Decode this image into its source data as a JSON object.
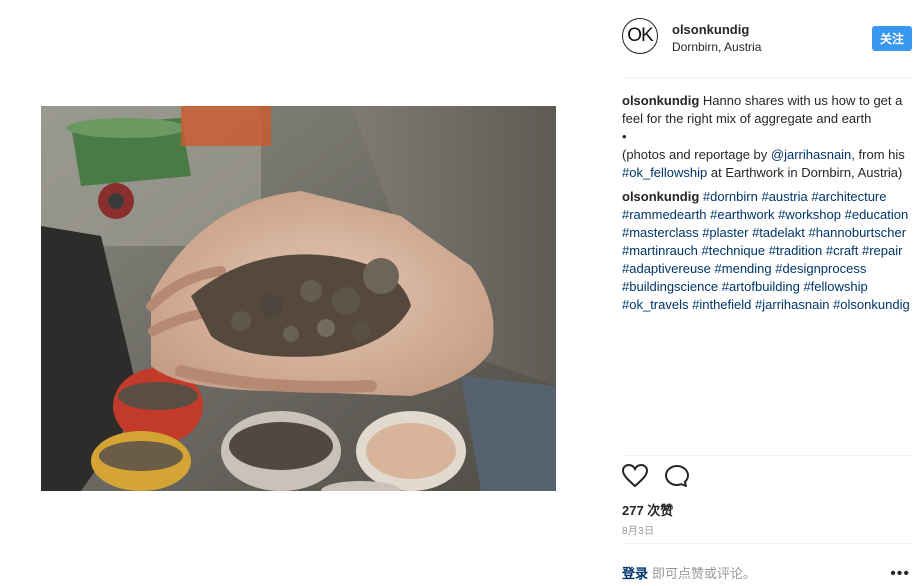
{
  "header": {
    "username": "olsonkundig",
    "location": "Dornbirn, Austria",
    "follow_label": "关注",
    "avatar_text": "OK"
  },
  "caption": {
    "username": "olsonkundig",
    "line1": "Hanno shares with us how to get a feel for the right mix of aggregate and earth",
    "bullet": "•",
    "line2_pre": "(photos and reportage by ",
    "mention": "@jarrihasnain",
    "line2_mid": ", from his ",
    "hashtag": "#ok_fellowship",
    "line2_post": " at Earthwork in Dornbirn, Austria)"
  },
  "tags_comment": {
    "username": "olsonkundig",
    "tags": [
      "#dornbirn",
      "#austria",
      "#architecture",
      "#rammedearth",
      "#earthwork",
      "#workshop",
      "#education",
      "#masterclass",
      "#plaster",
      "#tadelakt",
      "#hannoburtscher",
      "#martinrauch",
      "#technique",
      "#tradition",
      "#craft",
      "#repair",
      "#adaptivereuse",
      "#mending",
      "#designprocess",
      "#buildingscience",
      "#artofbuilding",
      "#fellowship",
      "#ok_travels",
      "#inthefield",
      "#jarrihasnain",
      "#olsonkundig"
    ]
  },
  "stats": {
    "likes": "277 次赞",
    "date": "8月3日"
  },
  "footer": {
    "login_label": "登录",
    "prompt": "即可点赞或评论。",
    "more": "•••"
  },
  "icons": {
    "like": "heart-icon",
    "comment": "comment-icon",
    "more": "more-icon"
  }
}
